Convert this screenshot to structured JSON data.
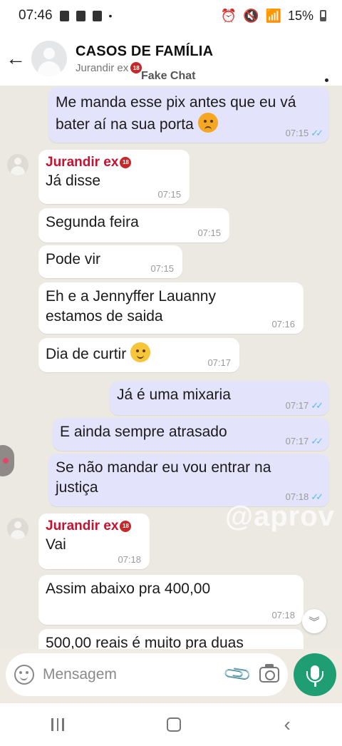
{
  "status_bar": {
    "time": "07:46",
    "battery": "15%",
    "dot": "•"
  },
  "header": {
    "title": "CASOS DE FAMÍLIA",
    "subtitle": "Jurandir ex",
    "badge": "18",
    "overlay_label": "Fake Chat"
  },
  "messages": [
    {
      "dir": "out",
      "text": "Me manda esse pix antes que eu vá bater aí na sua porta",
      "emoji": "angry-face",
      "time": "07:15"
    },
    {
      "dir": "in",
      "sender": "Jurandir ex",
      "text": "Já disse",
      "time": "07:15"
    },
    {
      "dir": "in",
      "text": "Segunda feira",
      "time": "07:15"
    },
    {
      "dir": "in",
      "text": "Pode vir",
      "time": "07:15"
    },
    {
      "dir": "in",
      "text": "Eh e a Jennyffer Lauanny estamos de saida",
      "time": "07:16"
    },
    {
      "dir": "in",
      "text": "Dia de curtir",
      "emoji": "hugging-face",
      "time": "07:17"
    },
    {
      "dir": "out",
      "text": "Já é uma mixaria",
      "time": "07:17"
    },
    {
      "dir": "out",
      "text": "E ainda sempre atrasado",
      "time": "07:17"
    },
    {
      "dir": "out",
      "text": "Se não mandar eu vou entrar na justiça",
      "time": "07:18"
    },
    {
      "dir": "in",
      "sender": "Jurandir ex",
      "text": "Vai",
      "time": "07:18"
    },
    {
      "dir": "in",
      "text": "Assim abaixo pra 400,00",
      "time": "07:18"
    },
    {
      "dir": "in",
      "text": "500,00 reais é muito pra duas",
      "time": ""
    }
  ],
  "watermark": "@aprov",
  "input": {
    "placeholder": "Mensagem"
  },
  "colors": {
    "accent": "#1f9e74",
    "outgoing_bubble": "#e3e4fb",
    "incoming_bubble": "#ffffff",
    "sender_name": "#c4122f",
    "chat_bg": "#ece8e2",
    "read_ticks": "#53bdeb"
  },
  "icons": [
    "back-arrow-icon",
    "more-vert-icon",
    "emoji-icon",
    "attach-icon",
    "camera-icon",
    "mic-icon",
    "scroll-down-icon",
    "nav-recents-icon",
    "nav-home-icon",
    "nav-back-icon"
  ]
}
